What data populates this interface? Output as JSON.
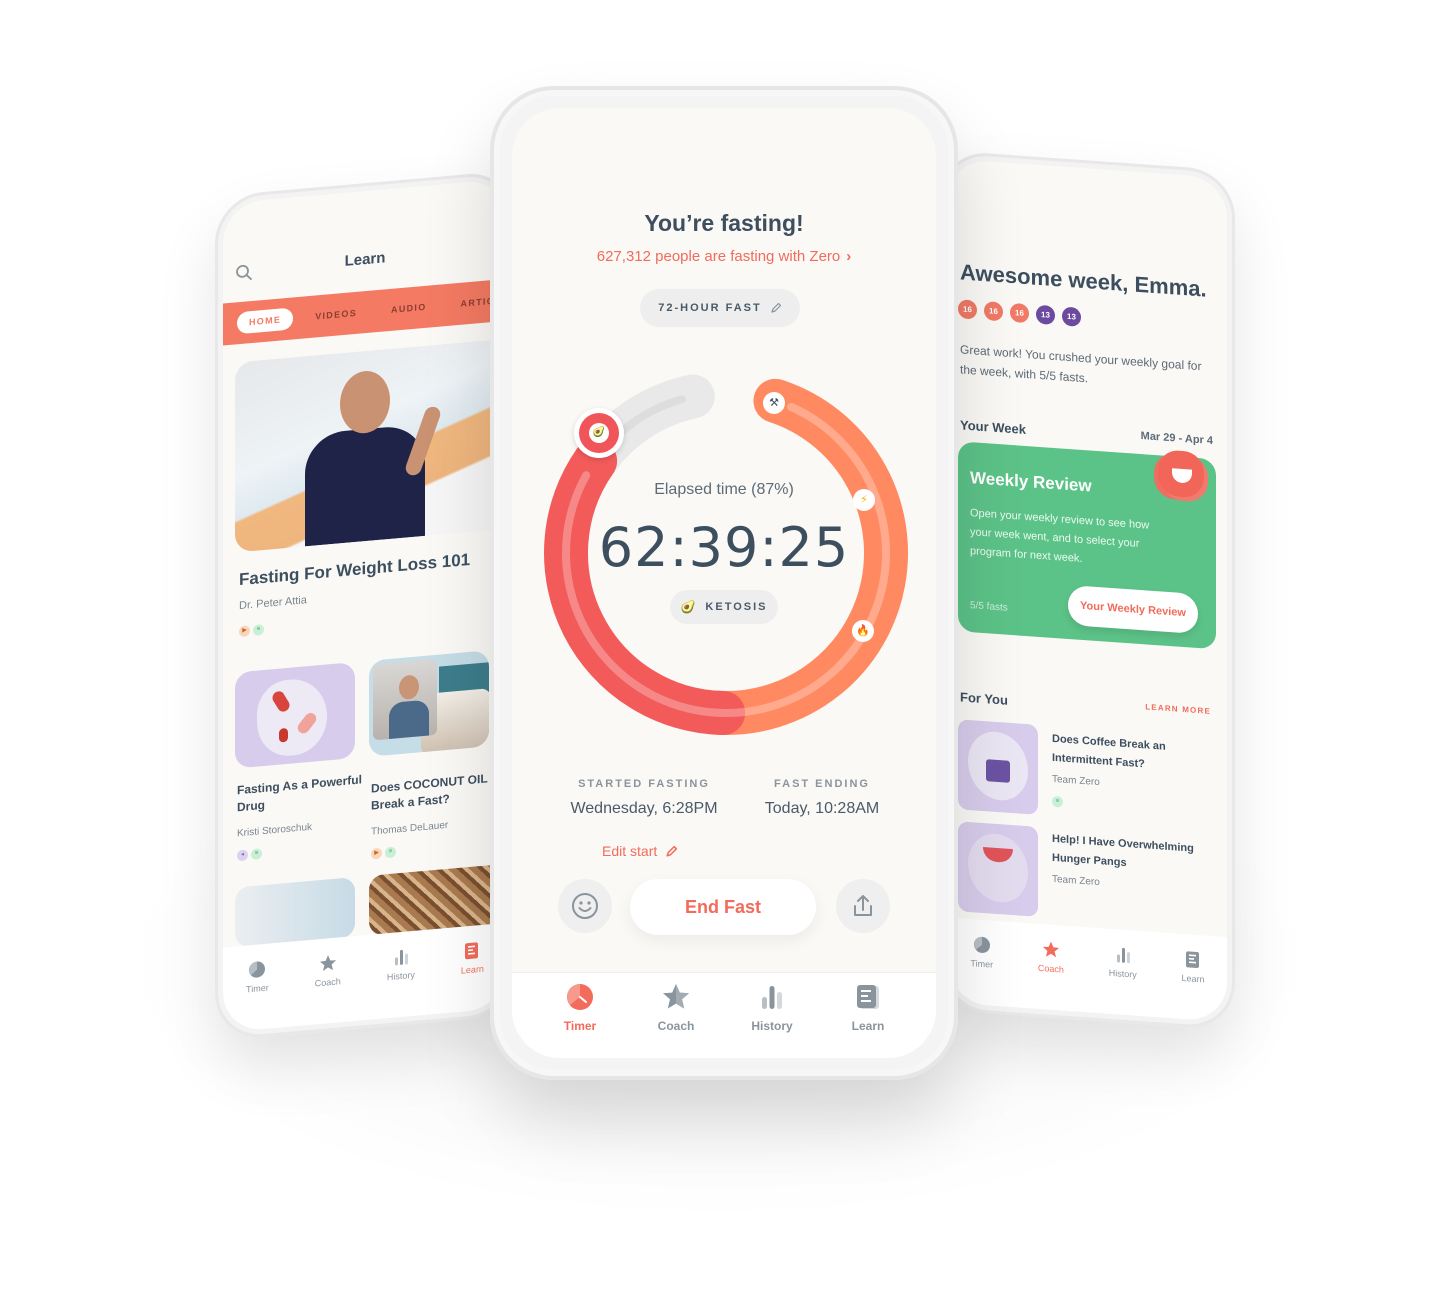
{
  "colors": {
    "accent": "#f26b5b",
    "ring_red": "#f35b5b",
    "ring_orange": "#ff8a62",
    "ring_track": "#e9e9e9",
    "text_dark": "#3d4f5f",
    "green_card": "#5cc388",
    "purple_dot": "#6b4aa0",
    "coral_dot": "#f07a66"
  },
  "left_phone": {
    "header": {
      "title": "Learn",
      "search_icon": "search-icon",
      "bookmark_icon": "bookmark-icon"
    },
    "tabs": [
      {
        "label": "HOME",
        "active": true
      },
      {
        "label": "VIDEOS",
        "active": false
      },
      {
        "label": "AUDIO",
        "active": false
      },
      {
        "label": "ARTICLES",
        "active": false
      }
    ],
    "featured": {
      "title": "Fasting For Weight Loss 101",
      "author": "Dr. Peter Attia",
      "badges": [
        "video",
        "article"
      ]
    },
    "grid": [
      {
        "title": "Fasting As a Powerful Drug",
        "author": "Kristi Storoschuk",
        "badges": [
          "audio",
          "article"
        ]
      },
      {
        "title": "Does COCONUT OIL Break a Fast?",
        "author": "Thomas DeLauer",
        "badges": [
          "video",
          "article"
        ]
      }
    ],
    "nav": [
      {
        "label": "Timer",
        "icon": "timer-icon",
        "active": false
      },
      {
        "label": "Coach",
        "icon": "star-icon",
        "active": false
      },
      {
        "label": "History",
        "icon": "bar-chart-icon",
        "active": false
      },
      {
        "label": "Learn",
        "icon": "book-icon",
        "active": true
      }
    ]
  },
  "center_phone": {
    "title": "You’re fasting!",
    "subtitle": "627,312 people are fasting with Zero",
    "subtitle_chevron": "›",
    "fast_type": "72-HOUR FAST",
    "timer": {
      "elapsed_label": "Elapsed time (87%)",
      "elapsed_percent": 87,
      "elapsed_time": "62:39:25",
      "stage": "KETOSIS",
      "stage_markers": [
        "tools-icon",
        "lightning-icon",
        "fire-icon",
        "avocado-icon"
      ]
    },
    "started": {
      "label": "STARTED FASTING",
      "value": "Wednesday, 6:28PM",
      "edit_label": "Edit start"
    },
    "ending": {
      "label": "FAST ENDING",
      "value": "Today, 10:28AM"
    },
    "end_fast_label": "End Fast",
    "nav": [
      {
        "label": "Timer",
        "icon": "timer-icon",
        "active": true
      },
      {
        "label": "Coach",
        "icon": "star-icon",
        "active": false
      },
      {
        "label": "History",
        "icon": "bar-chart-icon",
        "active": false
      },
      {
        "label": "Learn",
        "icon": "book-icon",
        "active": false
      }
    ]
  },
  "right_phone": {
    "title": "Awesome week, Emma.",
    "fast_dots": [
      {
        "value": "16",
        "kind": "coral"
      },
      {
        "value": "16",
        "kind": "coral"
      },
      {
        "value": "16",
        "kind": "coral"
      },
      {
        "value": "13",
        "kind": "purple"
      },
      {
        "value": "13",
        "kind": "purple"
      }
    ],
    "message": "Great work! You crushed your weekly goal for the week, with 5/5 fasts.",
    "your_week": {
      "label": "Your Week",
      "range": "Mar 29 - Apr 4"
    },
    "weekly_review": {
      "title": "Weekly Review",
      "text": "Open your weekly review to see how your week went, and to select your program for next week.",
      "count": "5/5 fasts",
      "button": "Your Weekly Review"
    },
    "for_you": {
      "label": "For You",
      "learn_more": "LEARN MORE",
      "items": [
        {
          "title": "Does Coffee Break an Intermittent Fast?",
          "author": "Team Zero"
        },
        {
          "title": "Help! I Have Overwhelming Hunger Pangs",
          "author": "Team Zero"
        }
      ]
    },
    "nav": [
      {
        "label": "Timer",
        "icon": "timer-icon",
        "active": false
      },
      {
        "label": "Coach",
        "icon": "star-icon",
        "active": true
      },
      {
        "label": "History",
        "icon": "bar-chart-icon",
        "active": false
      },
      {
        "label": "Learn",
        "icon": "book-icon",
        "active": false
      }
    ]
  }
}
